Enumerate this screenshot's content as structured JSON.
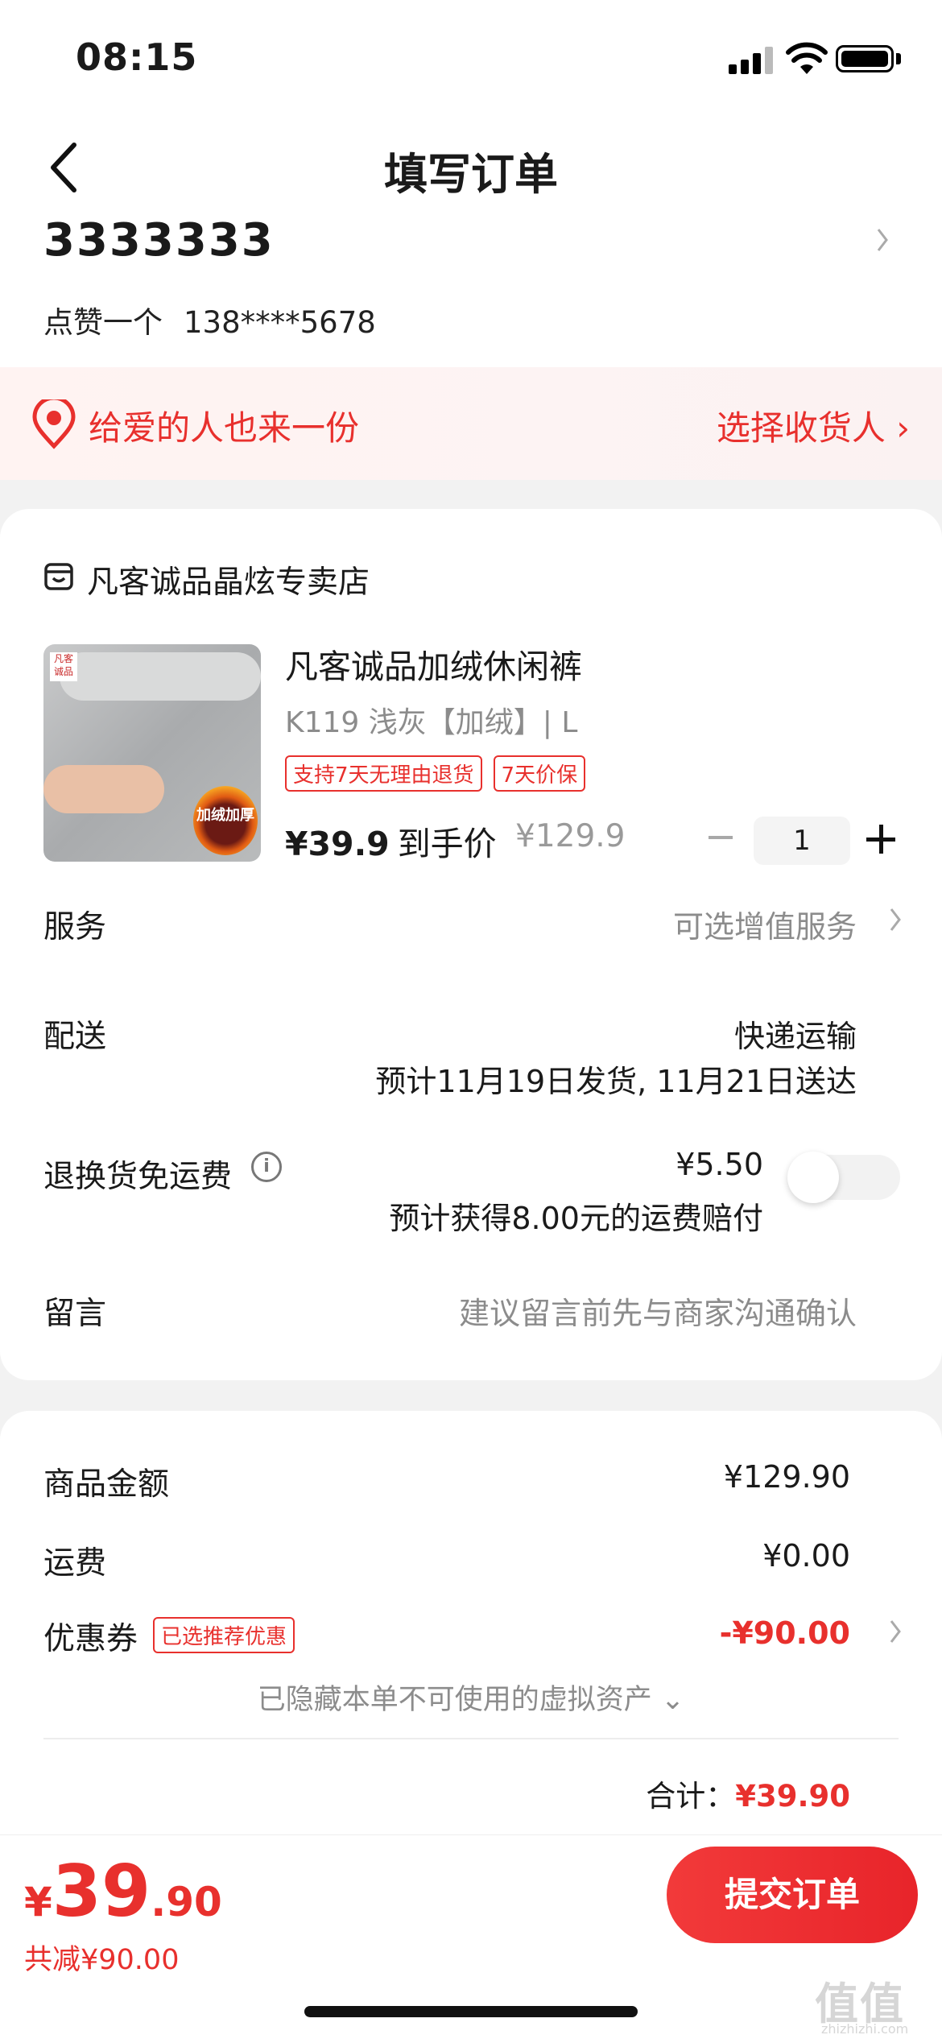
{
  "status": {
    "time": "08:15"
  },
  "header": {
    "title": "填写订单"
  },
  "address": {
    "name": "3333333",
    "recipient": "点赞一个",
    "phone": "138****5678"
  },
  "gift": {
    "text": "给爱的人也来一份",
    "action": "选择收货人 ›"
  },
  "shop": {
    "name": "凡客诚品晶炫专卖店"
  },
  "product": {
    "title": "凡客诚品加绒休闲裤",
    "sku": "K119 浅灰【加绒】| L",
    "tags": [
      "支持7天无理由退货",
      "7天价保"
    ],
    "price": "¥39.9",
    "price_label": "到手价",
    "original_price": "¥129.9",
    "quantity": "1",
    "image_brand": "凡客诚品",
    "image_badge": "加绒加厚"
  },
  "rows": {
    "service_label": "服务",
    "service_value": "可选增值服务",
    "delivery_label": "配送",
    "delivery_method": "快递运输",
    "delivery_eta": "预计11月19日发货, 11月21日送达",
    "return_label": "退换货免运费",
    "return_price": "¥5.50",
    "return_note": "预计获得8.00元的运费赔付",
    "message_label": "留言",
    "message_placeholder": "建议留言前先与商家沟通确认"
  },
  "summary": {
    "goods_label": "商品金额",
    "goods_value": "¥129.90",
    "shipping_label": "运费",
    "shipping_value": "¥0.00",
    "coupon_label": "优惠券",
    "coupon_tag": "已选推荐优惠",
    "coupon_value": "-¥90.00",
    "hidden_note": "已隐藏本单不可使用的虚拟资产 ⌄",
    "total_label": "合计：",
    "total_value": "¥39.90"
  },
  "bottom": {
    "currency": "¥",
    "price_int": "39",
    "price_dec": ".90",
    "saved": "共减¥90.00",
    "submit": "提交订单"
  },
  "watermark": {
    "text": "值值值",
    "sub": "zhizhizhi.com"
  },
  "colors": {
    "accent": "#e8302d",
    "background": "#f2f2f2"
  }
}
